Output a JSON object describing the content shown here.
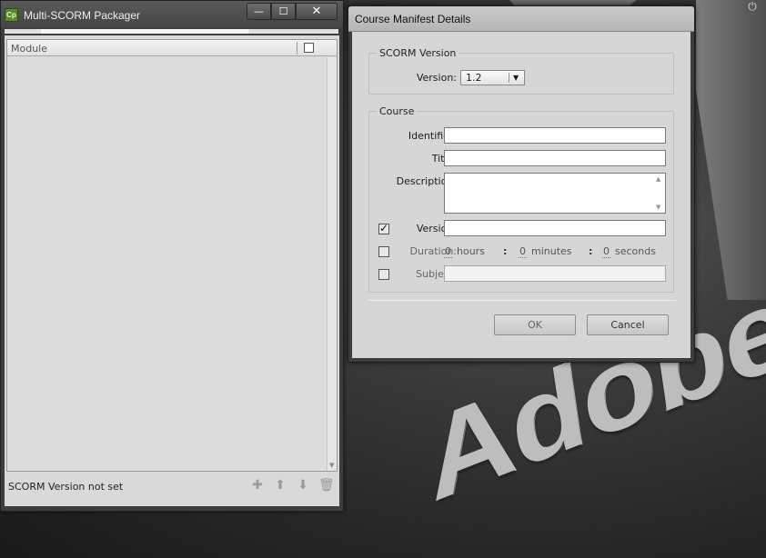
{
  "desktop": {
    "background_logo_text": "Adobe",
    "corner_glyph": "⏻"
  },
  "main_window": {
    "app_icon_text": "Cp",
    "title": "Multi-SCORM Packager",
    "controls": {
      "minimize": "—",
      "maximize": "☐",
      "close": "✕"
    },
    "list": {
      "column_header": "Module",
      "rows": []
    },
    "status": "SCORM Version not set",
    "toolbar_icons": [
      "add-icon",
      "move-up-icon",
      "move-down-icon",
      "delete-icon"
    ]
  },
  "dialog": {
    "title": "Course Manifest Details",
    "scorm_group": {
      "legend": "SCORM Version",
      "version_label": "Version:",
      "version_value": "1.2"
    },
    "course_group": {
      "legend": "Course",
      "identifier_label": "Identifier:",
      "identifier_value": "",
      "title_label": "Title:",
      "title_value": "",
      "description_label": "Description:",
      "description_value": "",
      "version_label": "Version:",
      "version_value": "",
      "version_checked": true,
      "duration_label": "Duration:",
      "duration_checked": false,
      "hours_value": "0",
      "hours_unit": "hours",
      "minutes_value": "0",
      "minutes_unit": "minutes",
      "seconds_value": "0",
      "seconds_unit": "seconds",
      "subject_label": "Subject:",
      "subject_value": "",
      "subject_checked": false
    },
    "buttons": {
      "ok": "OK",
      "cancel": "Cancel"
    }
  }
}
